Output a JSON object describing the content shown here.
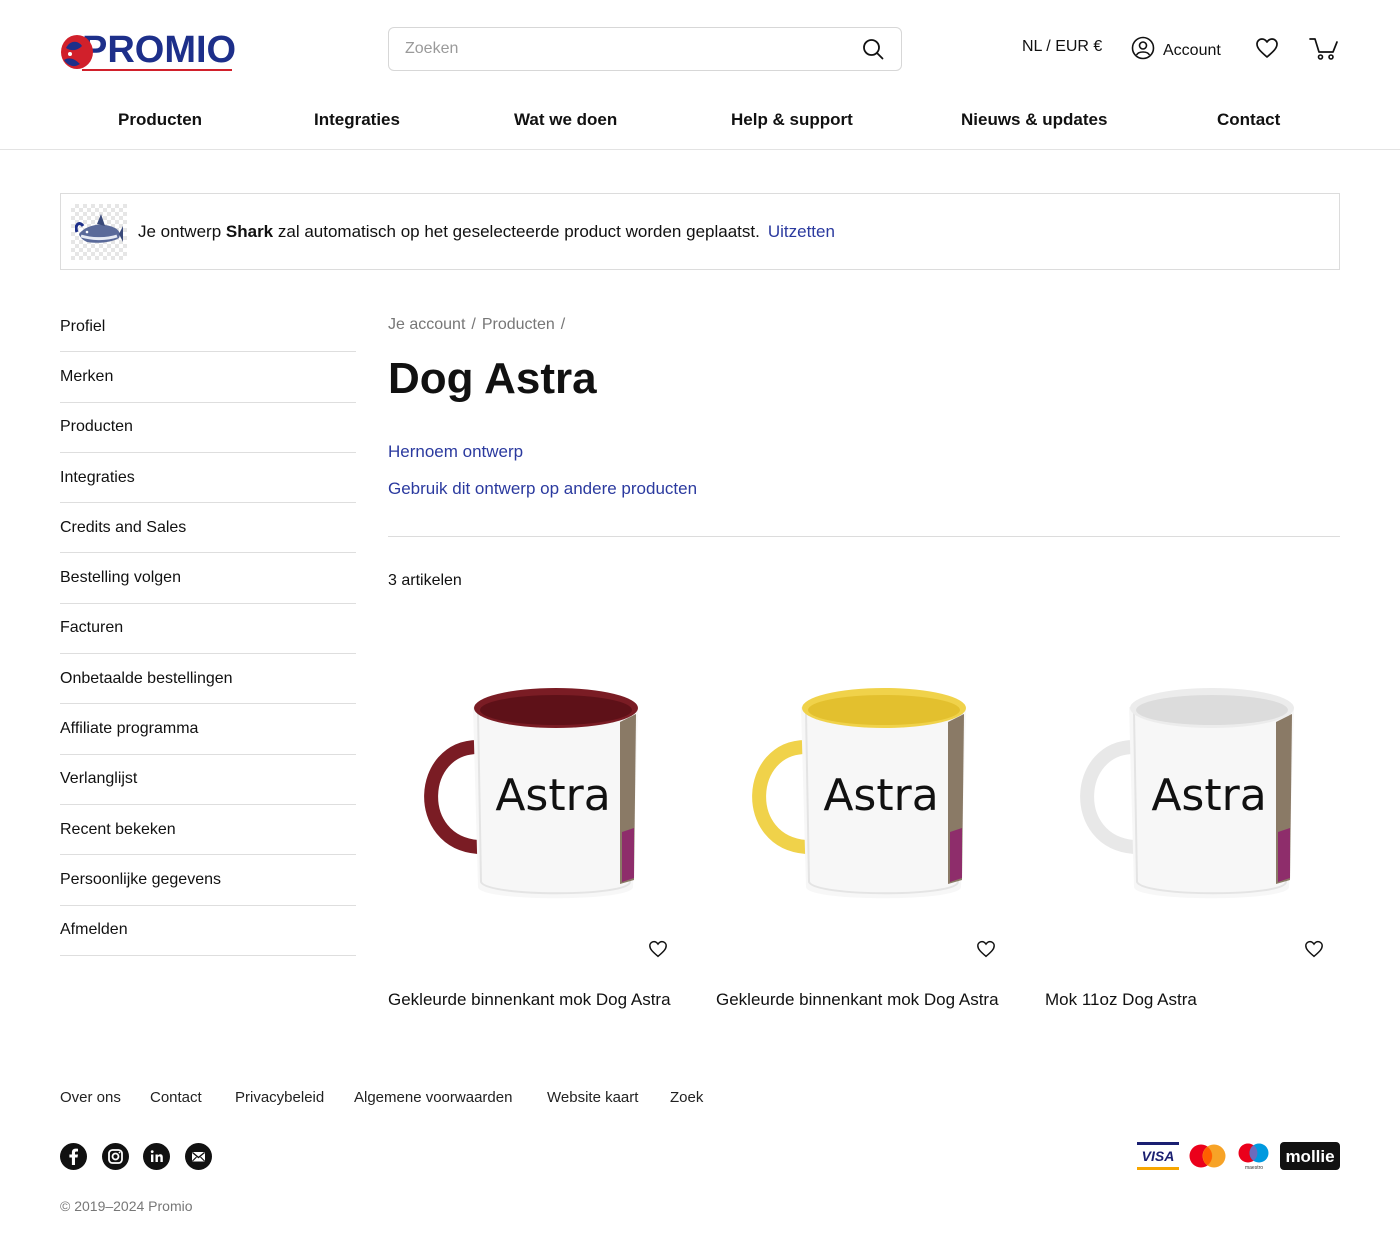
{
  "brand": {
    "name": "PROMIO",
    "colors": {
      "primary": "#1d2f8a",
      "accent": "#d1202b",
      "link": "#2b3a9f"
    }
  },
  "header": {
    "search_placeholder": "Zoeken",
    "locale": "NL / EUR €",
    "account_label": "Account",
    "icons": {
      "search": "search-icon",
      "account": "user-circle-icon",
      "wishlist": "heart-icon",
      "cart": "cart-icon"
    }
  },
  "nav": [
    "Producten",
    "Integraties",
    "Wat we doen",
    "Help & support",
    "Nieuws & updates",
    "Contact"
  ],
  "notice": {
    "text_before": "Je ontwerp ",
    "design_name": "Shark",
    "text_after": " zal automatisch op het geselecteerde product worden geplaatst.",
    "link": "Uitzetten"
  },
  "sidebar": [
    "Profiel",
    "Merken",
    "Producten",
    "Integraties",
    "Credits and Sales",
    "Bestelling volgen",
    "Facturen",
    "Onbetaalde bestellingen",
    "Affiliate programma",
    "Verlanglijst",
    "Recent bekeken",
    "Persoonlijke gegevens",
    "Afmelden"
  ],
  "breadcrumb": [
    "Je account",
    "Producten"
  ],
  "breadcrumb_sep": "/",
  "page_title": "Dog Astra",
  "actions": {
    "rename": "Hernoem ontwerp",
    "reuse": "Gebruik dit ontwerp op andere producten"
  },
  "item_count": "3 artikelen",
  "products": [
    {
      "title": "Gekleurde binnenkant mok Dog Astra",
      "mug_text": "Astra",
      "accent_color": "#7a1c24"
    },
    {
      "title": "Gekleurde binnenkant mok Dog Astra",
      "mug_text": "Astra",
      "accent_color": "#f0d24a"
    },
    {
      "title": "Mok 11oz Dog Astra",
      "mug_text": "Astra",
      "accent_color": "#e8e8e8"
    }
  ],
  "footer": {
    "links": [
      "Over ons",
      "Contact",
      "Privacybeleid",
      "Algemene voorwaarden",
      "Website kaart",
      "Zoek"
    ],
    "social": [
      "facebook-icon",
      "instagram-icon",
      "linkedin-icon",
      "mail-icon"
    ],
    "payments": {
      "visa": "VISA",
      "mastercard": "mastercard-logo",
      "maestro": "maestro",
      "mollie": "mollie"
    },
    "copyright": "© 2019–2024 Promio"
  }
}
